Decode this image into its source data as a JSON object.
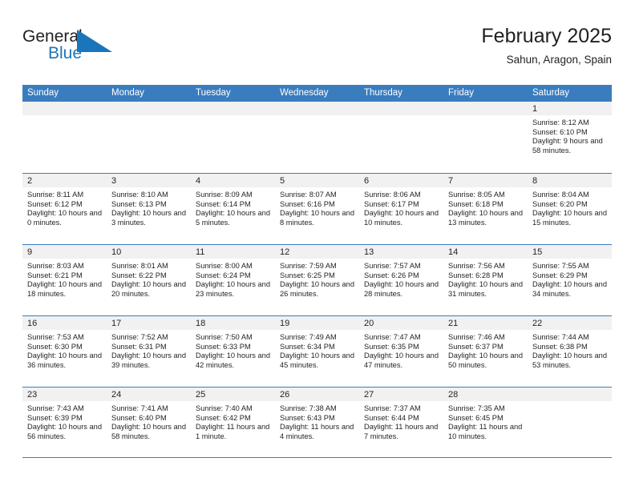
{
  "logo": {
    "word_top": "General",
    "word_bottom": "Blue",
    "accent_color": "#1b75bb"
  },
  "header": {
    "title": "February 2025",
    "subtitle": "Sahun, Aragon, Spain"
  },
  "calendar": {
    "header_color": "#3a7dbf",
    "weekdays": [
      "Sunday",
      "Monday",
      "Tuesday",
      "Wednesday",
      "Thursday",
      "Friday",
      "Saturday"
    ],
    "weeks": [
      [
        {
          "date": "",
          "empty": true
        },
        {
          "date": "",
          "empty": true
        },
        {
          "date": "",
          "empty": true
        },
        {
          "date": "",
          "empty": true
        },
        {
          "date": "",
          "empty": true
        },
        {
          "date": "",
          "empty": true
        },
        {
          "date": "1",
          "sunrise": "Sunrise: 8:12 AM",
          "sunset": "Sunset: 6:10 PM",
          "daylight": "Daylight: 9 hours and 58 minutes."
        }
      ],
      [
        {
          "date": "2",
          "sunrise": "Sunrise: 8:11 AM",
          "sunset": "Sunset: 6:12 PM",
          "daylight": "Daylight: 10 hours and 0 minutes."
        },
        {
          "date": "3",
          "sunrise": "Sunrise: 8:10 AM",
          "sunset": "Sunset: 6:13 PM",
          "daylight": "Daylight: 10 hours and 3 minutes."
        },
        {
          "date": "4",
          "sunrise": "Sunrise: 8:09 AM",
          "sunset": "Sunset: 6:14 PM",
          "daylight": "Daylight: 10 hours and 5 minutes."
        },
        {
          "date": "5",
          "sunrise": "Sunrise: 8:07 AM",
          "sunset": "Sunset: 6:16 PM",
          "daylight": "Daylight: 10 hours and 8 minutes."
        },
        {
          "date": "6",
          "sunrise": "Sunrise: 8:06 AM",
          "sunset": "Sunset: 6:17 PM",
          "daylight": "Daylight: 10 hours and 10 minutes."
        },
        {
          "date": "7",
          "sunrise": "Sunrise: 8:05 AM",
          "sunset": "Sunset: 6:18 PM",
          "daylight": "Daylight: 10 hours and 13 minutes."
        },
        {
          "date": "8",
          "sunrise": "Sunrise: 8:04 AM",
          "sunset": "Sunset: 6:20 PM",
          "daylight": "Daylight: 10 hours and 15 minutes."
        }
      ],
      [
        {
          "date": "9",
          "sunrise": "Sunrise: 8:03 AM",
          "sunset": "Sunset: 6:21 PM",
          "daylight": "Daylight: 10 hours and 18 minutes."
        },
        {
          "date": "10",
          "sunrise": "Sunrise: 8:01 AM",
          "sunset": "Sunset: 6:22 PM",
          "daylight": "Daylight: 10 hours and 20 minutes."
        },
        {
          "date": "11",
          "sunrise": "Sunrise: 8:00 AM",
          "sunset": "Sunset: 6:24 PM",
          "daylight": "Daylight: 10 hours and 23 minutes."
        },
        {
          "date": "12",
          "sunrise": "Sunrise: 7:59 AM",
          "sunset": "Sunset: 6:25 PM",
          "daylight": "Daylight: 10 hours and 26 minutes."
        },
        {
          "date": "13",
          "sunrise": "Sunrise: 7:57 AM",
          "sunset": "Sunset: 6:26 PM",
          "daylight": "Daylight: 10 hours and 28 minutes."
        },
        {
          "date": "14",
          "sunrise": "Sunrise: 7:56 AM",
          "sunset": "Sunset: 6:28 PM",
          "daylight": "Daylight: 10 hours and 31 minutes."
        },
        {
          "date": "15",
          "sunrise": "Sunrise: 7:55 AM",
          "sunset": "Sunset: 6:29 PM",
          "daylight": "Daylight: 10 hours and 34 minutes."
        }
      ],
      [
        {
          "date": "16",
          "sunrise": "Sunrise: 7:53 AM",
          "sunset": "Sunset: 6:30 PM",
          "daylight": "Daylight: 10 hours and 36 minutes."
        },
        {
          "date": "17",
          "sunrise": "Sunrise: 7:52 AM",
          "sunset": "Sunset: 6:31 PM",
          "daylight": "Daylight: 10 hours and 39 minutes."
        },
        {
          "date": "18",
          "sunrise": "Sunrise: 7:50 AM",
          "sunset": "Sunset: 6:33 PM",
          "daylight": "Daylight: 10 hours and 42 minutes."
        },
        {
          "date": "19",
          "sunrise": "Sunrise: 7:49 AM",
          "sunset": "Sunset: 6:34 PM",
          "daylight": "Daylight: 10 hours and 45 minutes."
        },
        {
          "date": "20",
          "sunrise": "Sunrise: 7:47 AM",
          "sunset": "Sunset: 6:35 PM",
          "daylight": "Daylight: 10 hours and 47 minutes."
        },
        {
          "date": "21",
          "sunrise": "Sunrise: 7:46 AM",
          "sunset": "Sunset: 6:37 PM",
          "daylight": "Daylight: 10 hours and 50 minutes."
        },
        {
          "date": "22",
          "sunrise": "Sunrise: 7:44 AM",
          "sunset": "Sunset: 6:38 PM",
          "daylight": "Daylight: 10 hours and 53 minutes."
        }
      ],
      [
        {
          "date": "23",
          "sunrise": "Sunrise: 7:43 AM",
          "sunset": "Sunset: 6:39 PM",
          "daylight": "Daylight: 10 hours and 56 minutes."
        },
        {
          "date": "24",
          "sunrise": "Sunrise: 7:41 AM",
          "sunset": "Sunset: 6:40 PM",
          "daylight": "Daylight: 10 hours and 58 minutes."
        },
        {
          "date": "25",
          "sunrise": "Sunrise: 7:40 AM",
          "sunset": "Sunset: 6:42 PM",
          "daylight": "Daylight: 11 hours and 1 minute."
        },
        {
          "date": "26",
          "sunrise": "Sunrise: 7:38 AM",
          "sunset": "Sunset: 6:43 PM",
          "daylight": "Daylight: 11 hours and 4 minutes."
        },
        {
          "date": "27",
          "sunrise": "Sunrise: 7:37 AM",
          "sunset": "Sunset: 6:44 PM",
          "daylight": "Daylight: 11 hours and 7 minutes."
        },
        {
          "date": "28",
          "sunrise": "Sunrise: 7:35 AM",
          "sunset": "Sunset: 6:45 PM",
          "daylight": "Daylight: 11 hours and 10 minutes."
        },
        {
          "date": "",
          "empty": true
        }
      ]
    ]
  }
}
